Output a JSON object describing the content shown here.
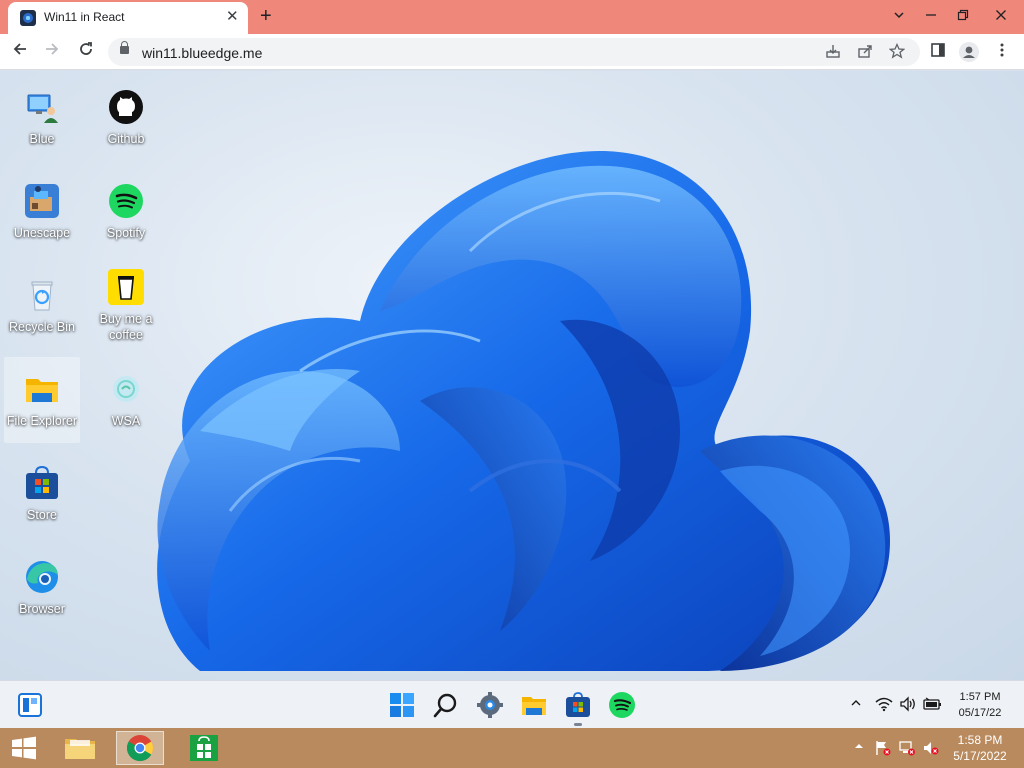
{
  "browser": {
    "tab_title": "Win11 in React",
    "tab_close": "✕",
    "new_tab": "+",
    "url": "win11.blueedge.me"
  },
  "desktop": {
    "icons": [
      {
        "label": "Blue",
        "icon": "computer-user-icon"
      },
      {
        "label": "Github",
        "icon": "github-icon"
      },
      {
        "label": "Unescape",
        "icon": "unescape-game-icon"
      },
      {
        "label": "Spotify",
        "icon": "spotify-icon"
      },
      {
        "label": "Recycle Bin",
        "icon": "recycle-bin-icon"
      },
      {
        "label": "Buy me a coffee",
        "icon": "coffee-cup-icon"
      },
      {
        "label": "File Explorer",
        "icon": "folder-icon"
      },
      {
        "label": "WSA",
        "icon": "wsa-android-icon"
      },
      {
        "label": "Store",
        "icon": "store-icon"
      },
      {
        "label": "Browser",
        "icon": "edge-icon"
      }
    ]
  },
  "w11_taskbar": {
    "time": "1:57 PM",
    "date": "05/17/22"
  },
  "host_taskbar": {
    "time": "1:58 PM",
    "date": "5/17/2022"
  },
  "colors": {
    "titlebar": "#f0877b",
    "host_taskbar": "#b88a5e",
    "bloom_blue": "#1a6fe6"
  }
}
